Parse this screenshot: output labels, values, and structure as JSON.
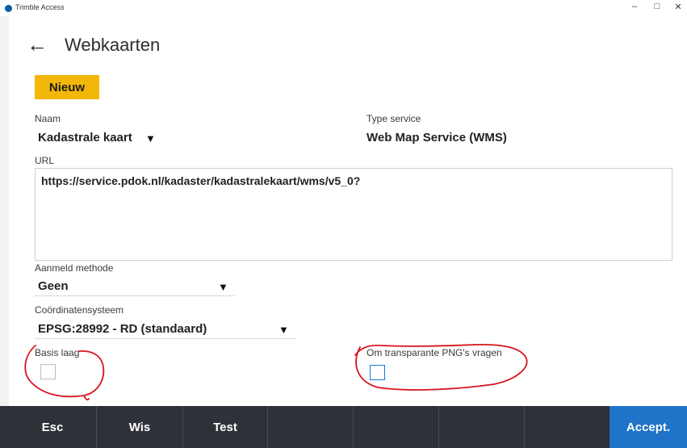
{
  "window": {
    "title": "Trimble Access",
    "minimize": "–",
    "maximize": "□",
    "close": "✕"
  },
  "header": {
    "back_icon": "←",
    "title": "Webkaarten"
  },
  "toolbar": {
    "new_label": "Nieuw"
  },
  "form": {
    "name_label": "Naam",
    "name_value": "Kadastrale kaart",
    "service_type_label": "Type service",
    "service_type_value": "Web Map Service (WMS)",
    "url_label": "URL",
    "url_value": "https://service.pdok.nl/kadaster/kadastralekaart/wms/v5_0?",
    "login_method_label": "Aanmeld methode",
    "login_method_value": "Geen",
    "crs_label": "Coördinatensysteem",
    "crs_value": "EPSG:28992 - RD (standaard)",
    "base_layer_label": "Basis laag",
    "base_layer_checked": false,
    "transparent_png_label": "Om transparante PNG's vragen",
    "transparent_png_checked": false,
    "caret": "▼"
  },
  "softkeys": {
    "esc": "Esc",
    "clear": "Wis",
    "test": "Test",
    "accept": "Accept."
  },
  "colors": {
    "accent_yellow": "#f3b709",
    "softkey_bar": "#2f3139",
    "accept_blue": "#1f73c9",
    "annotation_red": "#d8141b",
    "checkbox_focus": "#1e73d8"
  }
}
